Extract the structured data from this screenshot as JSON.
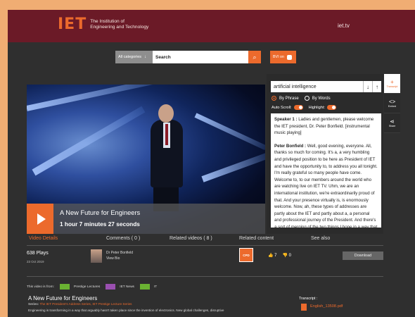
{
  "header": {
    "logo_mark": "IET",
    "logo_line1": "The Institution of",
    "logo_line2": "Engineering and Technology",
    "site_link": "iet.tv"
  },
  "search": {
    "category": "All categories",
    "value": "Search",
    "bvi_label": "BVI on"
  },
  "player": {
    "title": "A New Future for Engineers",
    "duration": "1 hour 7 minutes 27 seconds"
  },
  "transcript_panel": {
    "query": "artificial intelligence",
    "by_phrase": "By Phrase",
    "by_words": "By Words",
    "auto_scroll": "Auto Scroll:",
    "highlight": "Highlight:",
    "speaker1": "Speaker 1 :",
    "speaker1_text": "Ladies and gentlemen, please welcome the IET president, Dr. Peter Bonfield. [instrumental music playing]",
    "speaker2": "Peter Bonfield :",
    "speaker2_text": "Well, good evening, everyone. All, thanks so much for coming. It's a, a very humbling and privileged position to be here as President of IET and have the opportunity to, to address you all tonight. I'm really grateful so many people have come. Welcome to, to our members around the world who are watching live on IET TV. Uhm, we are an international institution, we're extraordinarily proud of that. And your presence virtually is, is enormously welcome. Now, ah, these types of addresses are partly about the IET and partly about a, a personal and professional journey of the President. And there's a sort of merging of the two things I hope in a way that one links to where we've been as an institution"
  },
  "side_tools": {
    "transcript": "Transcript",
    "embed": "Embed",
    "share": "Share"
  },
  "tabs": {
    "video_details": "Video Details",
    "comments": "Comments ( 0 )",
    "related_videos": "Related videos ( 8 )",
    "related_content": "Related content",
    "see_also": "See also"
  },
  "details": {
    "plays": "638 Plays",
    "date": "23 Oct 2019",
    "speaker_name": "Dr Peter Bonfield",
    "speaker_link": "View Bio",
    "cpd": "CPD",
    "likes": "7",
    "dislikes": "0",
    "download": "Download"
  },
  "from_row": {
    "label": "This video is from:",
    "chan1": "Prestige Lectures",
    "chan2": "IET News",
    "chan3": "IT"
  },
  "description": {
    "title": "A New Future for Engineers",
    "series_label": "Series:",
    "series_links": "The IET President's Address Series, IET Prestige Lecture Series",
    "text": "Engineering is transforming in a way that arguably hasn't taken place since the invention of electronics. New global challenges, disruptive",
    "transcript_label": "Transcript :",
    "transcript_file": "English_13508.pdf"
  },
  "colors": {
    "brand": "#6b1a27",
    "accent": "#ec6a2c",
    "background": "#2f2f2f"
  }
}
